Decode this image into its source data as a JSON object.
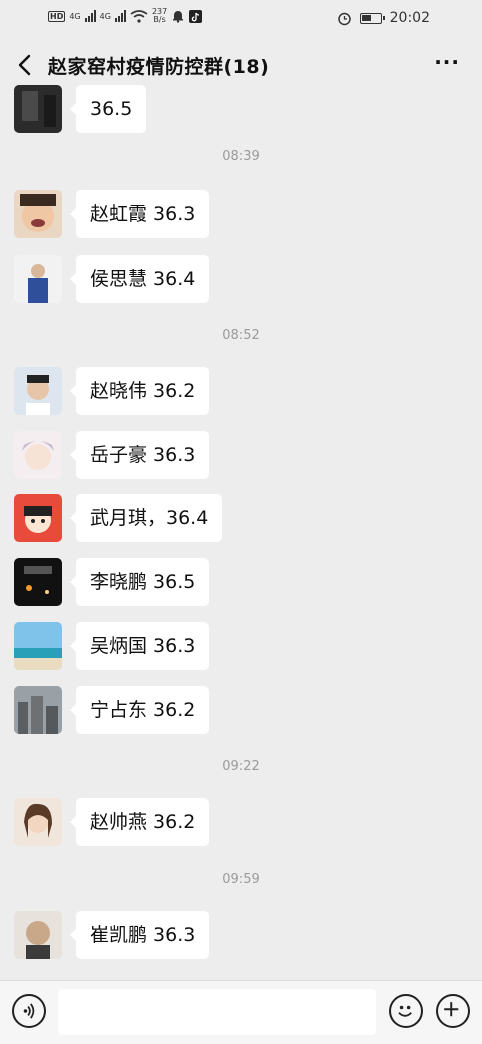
{
  "status_bar": {
    "network_badge": "HD",
    "signal_1": "4G",
    "signal_2": "4G",
    "speed_value": "237",
    "speed_unit": "B/s",
    "time": "20:02",
    "icons": [
      "wifi-icon",
      "notification-bell-icon",
      "tiktok-icon",
      "alarm-icon",
      "battery-icon"
    ]
  },
  "header": {
    "title": "赵家窑村疫情防控群(18)",
    "back_icon": "chevron-left-icon",
    "more_icon": "more-dots-icon",
    "more_label": "···"
  },
  "messages": [
    {
      "type": "msg",
      "text": "36.5",
      "avatar": "dark"
    },
    {
      "type": "time",
      "text": "08:39"
    },
    {
      "type": "msg",
      "text": "赵虹霞 36.3",
      "avatar": "child"
    },
    {
      "type": "msg",
      "text": "侯思慧 36.4",
      "avatar": "man-blue"
    },
    {
      "type": "time",
      "text": "08:52"
    },
    {
      "type": "msg",
      "text": "赵晓伟 36.2",
      "avatar": "man"
    },
    {
      "type": "msg",
      "text": "岳子豪 36.3",
      "avatar": "anime"
    },
    {
      "type": "msg",
      "text": "武月琪，36.4",
      "avatar": "cartoon"
    },
    {
      "type": "msg",
      "text": "李晓鹏 36.5",
      "avatar": "night"
    },
    {
      "type": "msg",
      "text": "吴炳国 36.3",
      "avatar": "beach"
    },
    {
      "type": "msg",
      "text": "宁占东 36.2",
      "avatar": "city"
    },
    {
      "type": "time",
      "text": "09:22"
    },
    {
      "type": "msg",
      "text": "赵帅燕 36.2",
      "avatar": "woman"
    },
    {
      "type": "time",
      "text": "09:59"
    },
    {
      "type": "msg",
      "text": "崔凯鹏 36.3",
      "avatar": "kid"
    }
  ],
  "input_bar": {
    "voice_icon": "voice-icon",
    "emoji_icon": "emoji-icon",
    "plus_icon": "plus-icon",
    "input_value": ""
  }
}
